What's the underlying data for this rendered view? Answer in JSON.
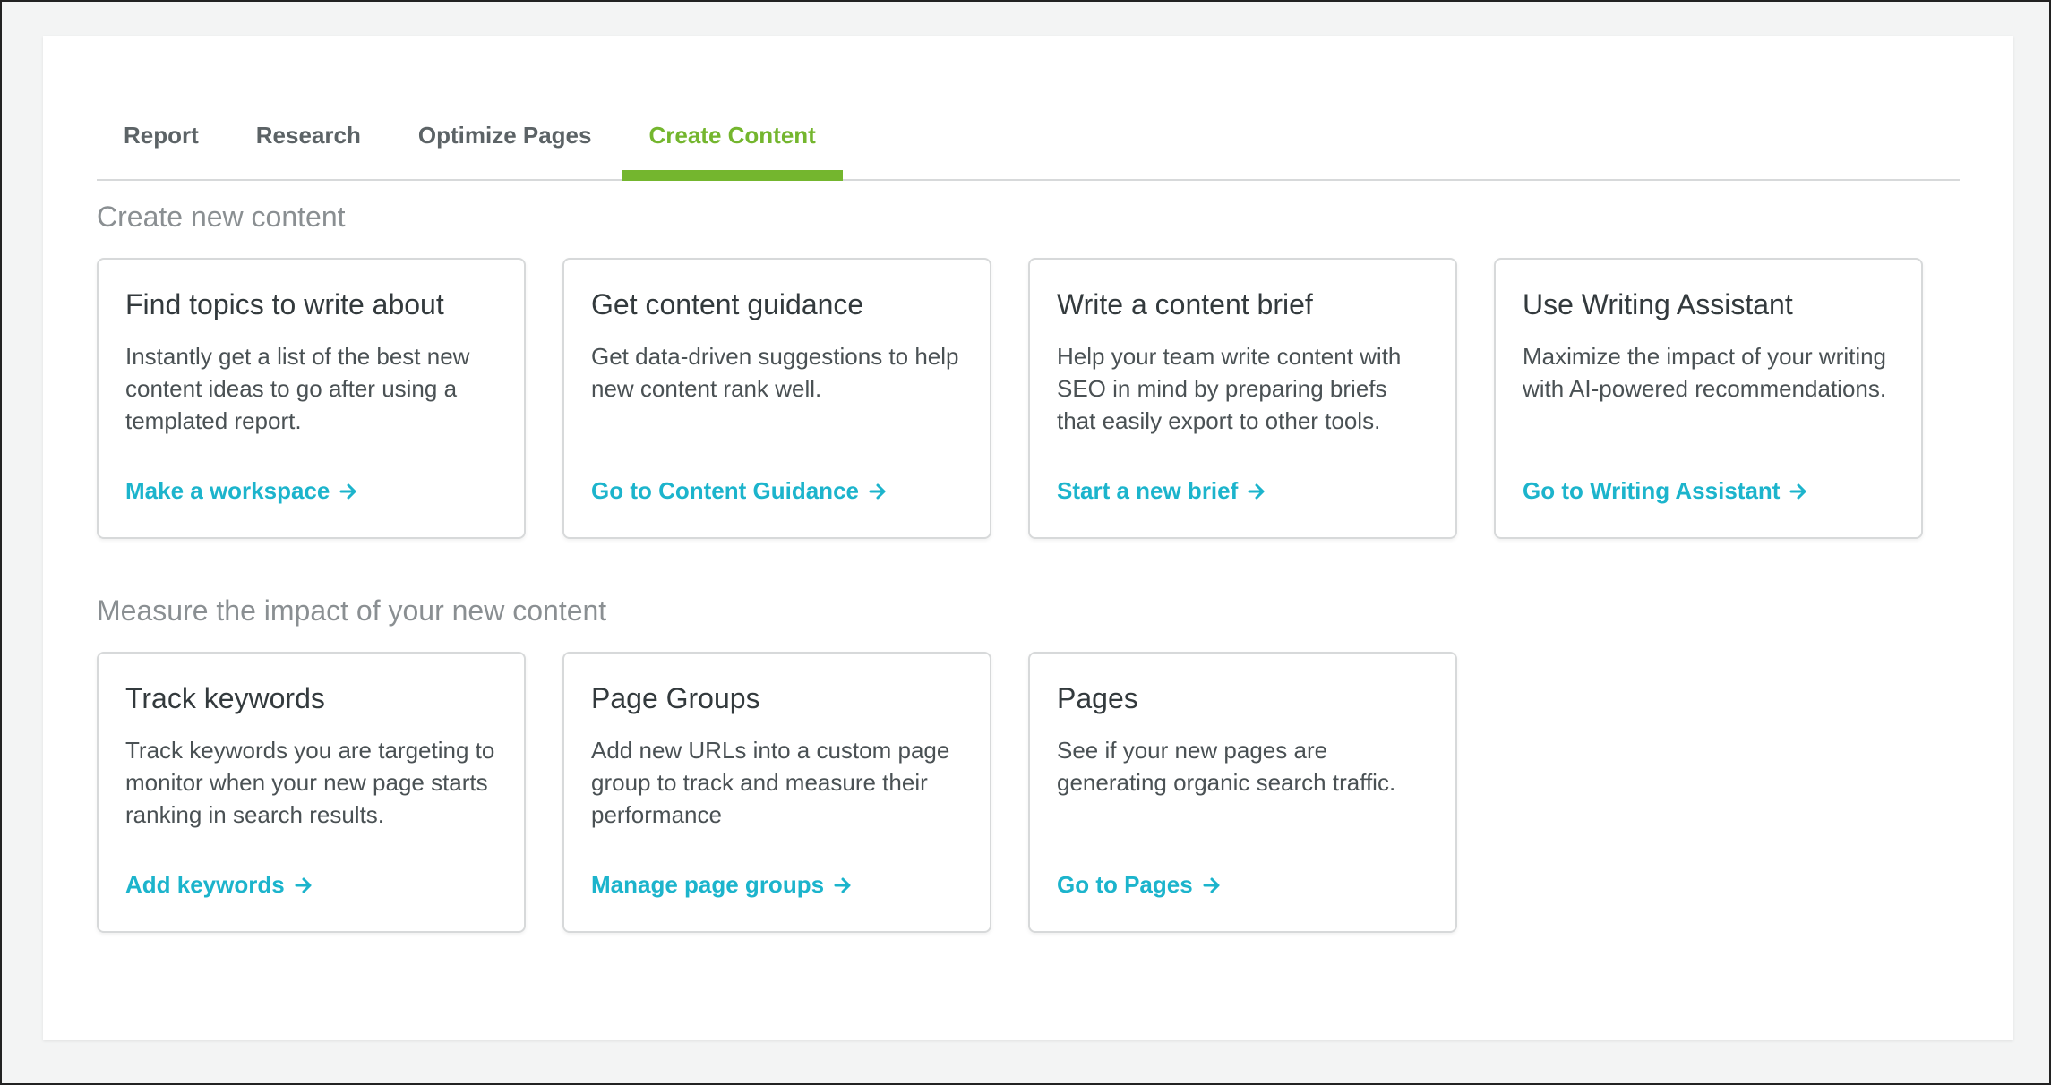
{
  "tabs": [
    {
      "label": "Report",
      "active": false
    },
    {
      "label": "Research",
      "active": false
    },
    {
      "label": "Optimize Pages",
      "active": false
    },
    {
      "label": "Create Content",
      "active": true
    }
  ],
  "sections": {
    "create": {
      "title": "Create new content",
      "cards": [
        {
          "title": "Find topics to write about",
          "description": "Instantly get a list of the best new content ideas to go after using a templated report.",
          "link": "Make a workspace"
        },
        {
          "title": "Get content guidance",
          "description": "Get data-driven suggestions to help new content rank well.",
          "link": "Go to Content Guidance"
        },
        {
          "title": "Write a content brief",
          "description": "Help your team write content with SEO in mind by preparing briefs that easily export to other tools.",
          "link": "Start a new brief"
        },
        {
          "title": "Use Writing Assistant",
          "description": "Maximize the impact of your writing with AI-powered recommendations.",
          "link": "Go to Writing Assistant"
        }
      ]
    },
    "measure": {
      "title": "Measure the impact of your new content",
      "cards": [
        {
          "title": "Track keywords",
          "description": "Track keywords you are targeting to monitor when your new page starts ranking in search results.",
          "link": "Add keywords"
        },
        {
          "title": "Page Groups",
          "description": "Add new URLs into a custom page group to track and measure their performance",
          "link": "Manage page groups"
        },
        {
          "title": "Pages",
          "description": "See if your new pages are generating organic search traffic.",
          "link": "Go to Pages"
        }
      ]
    }
  },
  "colors": {
    "accent_green": "#74b62e",
    "link_teal": "#1cb4cc"
  },
  "icons": {
    "link_arrow": "arrow-right-icon"
  }
}
